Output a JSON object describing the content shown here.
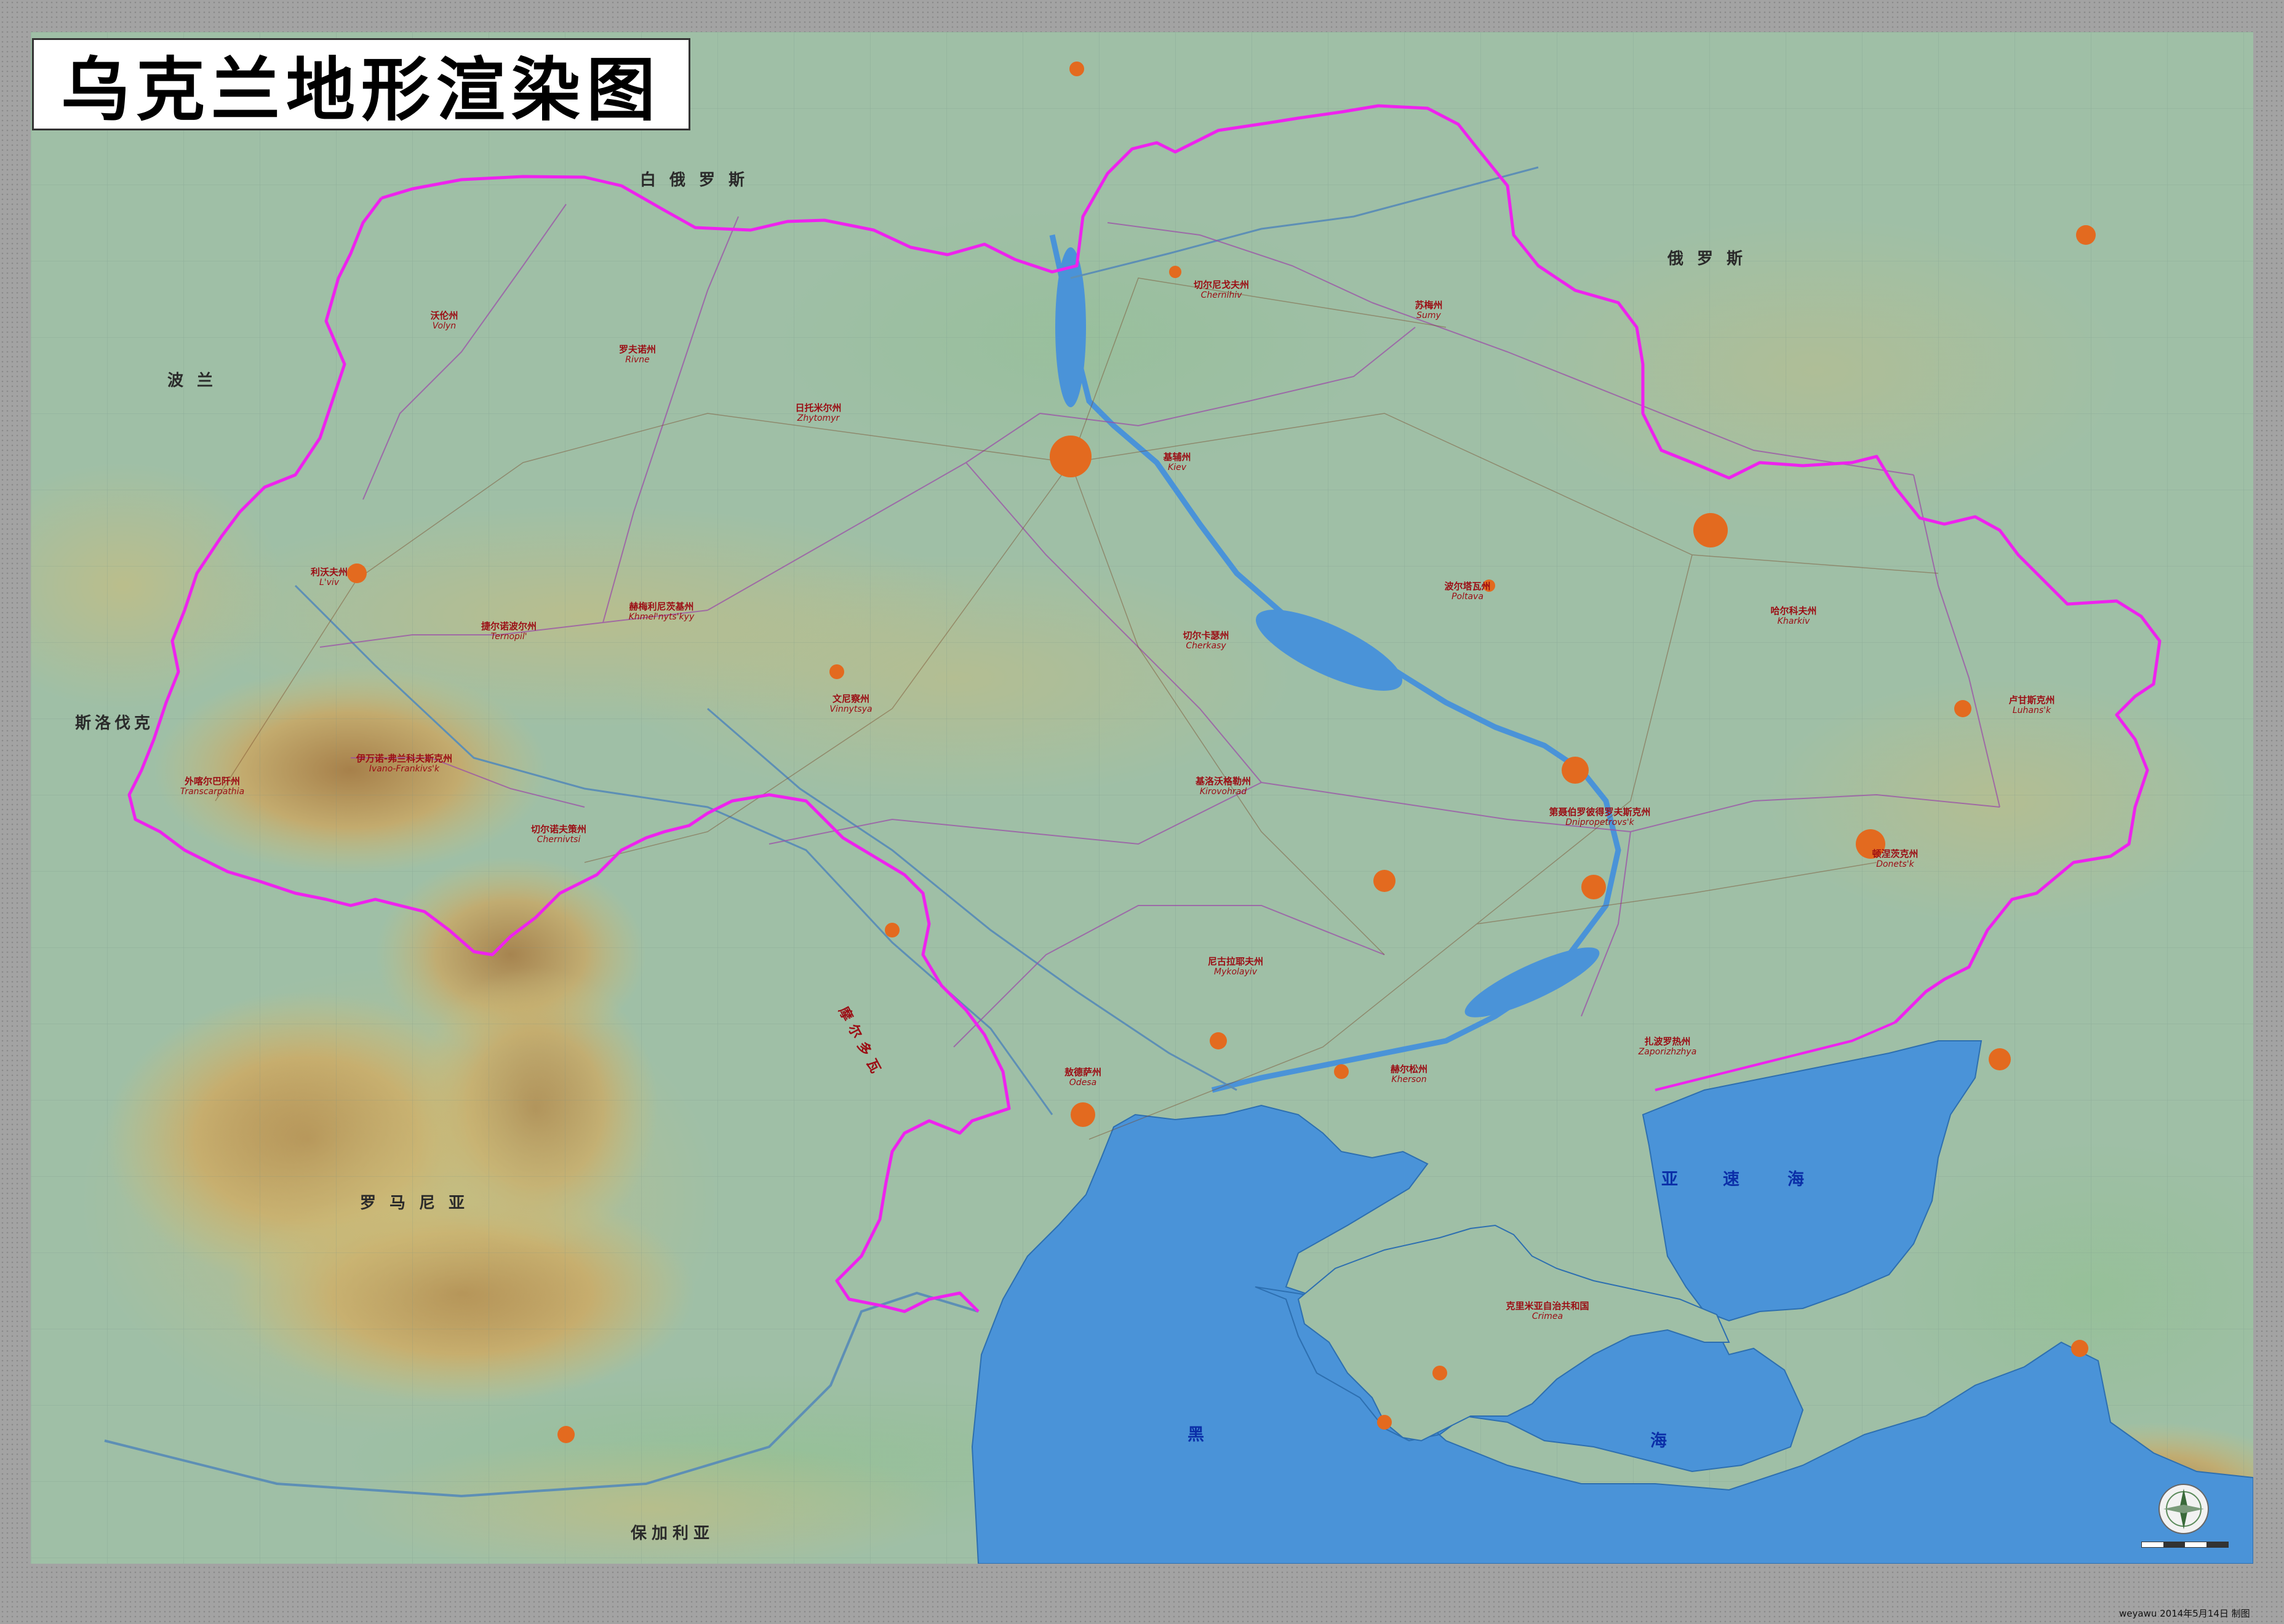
{
  "title": "乌克兰地形渲染图",
  "colors": {
    "border": "#ee22ee",
    "sea": "#4a93d8",
    "lowland": "#9cc2a4",
    "hill": "#c9bf7d",
    "mountain": "#b5884a",
    "city": "#e36a1f",
    "label_red": "#9b0d14",
    "label_blue": "#0b2fa8"
  },
  "countries": {
    "belarus": "白俄罗斯",
    "russia": "俄罗斯",
    "poland": "波兰",
    "slovakia": "斯洛伐克",
    "romania": "罗马尼亚",
    "bulgaria": "保加利亚",
    "moldova": "摩尔多瓦"
  },
  "seas": {
    "azov": [
      "亚",
      "速",
      "海"
    ],
    "black": [
      "黑",
      "海"
    ]
  },
  "regions": [
    {
      "zh": "沃伦州",
      "en": "Volyn"
    },
    {
      "zh": "罗夫诺州",
      "en": "Rivne"
    },
    {
      "zh": "日托米尔州",
      "en": "Zhytomyr"
    },
    {
      "zh": "切尔尼戈夫州",
      "en": "Chernihiv"
    },
    {
      "zh": "苏梅州",
      "en": "Sumy"
    },
    {
      "zh": "基辅州",
      "en": "Kiev"
    },
    {
      "zh": "利沃夫州",
      "en": "L'viv"
    },
    {
      "zh": "捷尔诺波尔州",
      "en": "Ternopil'"
    },
    {
      "zh": "赫梅利尼茨基州",
      "en": "Khmel'nyts'kyy"
    },
    {
      "zh": "切尔卡瑟州",
      "en": "Cherkasy"
    },
    {
      "zh": "波尔塔瓦州",
      "en": "Poltava"
    },
    {
      "zh": "哈尔科夫州",
      "en": "Kharkiv"
    },
    {
      "zh": "文尼察州",
      "en": "Vinnytsya"
    },
    {
      "zh": "外喀尔巴阡州",
      "en": "Transcarpathia"
    },
    {
      "zh": "伊万诺-弗兰科夫斯克州",
      "en": "Ivano-Frankivs'k"
    },
    {
      "zh": "切尔诺夫策州",
      "en": "Chernivtsi"
    },
    {
      "zh": "基洛沃格勒州",
      "en": "Kirovohrad"
    },
    {
      "zh": "第聂伯罗彼得罗夫斯克州",
      "en": "Dnipropetrovs'k"
    },
    {
      "zh": "卢甘斯克州",
      "en": "Luhans'k"
    },
    {
      "zh": "顿涅茨克州",
      "en": "Donets'k"
    },
    {
      "zh": "尼古拉耶夫州",
      "en": "Mykolayiv"
    },
    {
      "zh": "扎波罗热州",
      "en": "Zaporizhzhya"
    },
    {
      "zh": "敖德萨州",
      "en": "Odesa"
    },
    {
      "zh": "赫尔松州",
      "en": "Kherson"
    },
    {
      "zh": "克里米亚自治共和国",
      "en": "Crimea"
    }
  ],
  "credit": "weyawu 2014年5月14日 制图"
}
